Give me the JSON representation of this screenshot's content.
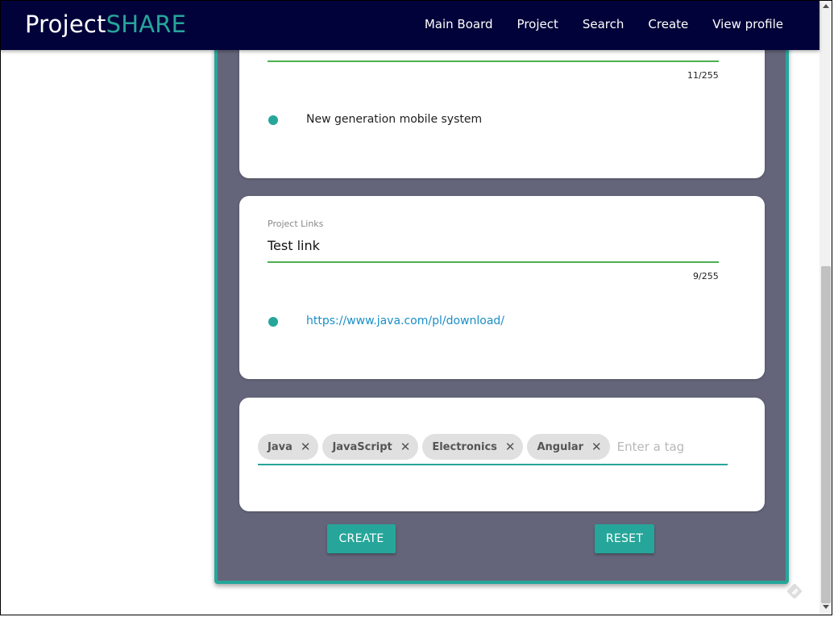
{
  "navbar": {
    "brand_prefix": "Project",
    "brand_suffix": "SHARE",
    "links": [
      "Main Board",
      "Project",
      "Search",
      "Create",
      "View profile"
    ]
  },
  "description_card": {
    "counter": "11/255",
    "items": [
      "New generation mobile system"
    ]
  },
  "links_card": {
    "label": "Project Links",
    "value": "Test link",
    "counter": "9/255",
    "items": [
      "https://www.java.com/pl/download/"
    ]
  },
  "tags_card": {
    "chips": [
      "Java",
      "JavaScript",
      "Electronics",
      "Angular"
    ],
    "input_placeholder": "Enter a tag"
  },
  "actions": {
    "create_label": "CREATE",
    "reset_label": "RESET"
  },
  "colors": {
    "navbar": "#02023a",
    "accent": "#26a69a",
    "panel": "#64657a",
    "underline": "#4caf50",
    "link": "#1a8fc7"
  },
  "icons": {
    "chip_close": "close-icon",
    "corner": "edit-icon"
  }
}
